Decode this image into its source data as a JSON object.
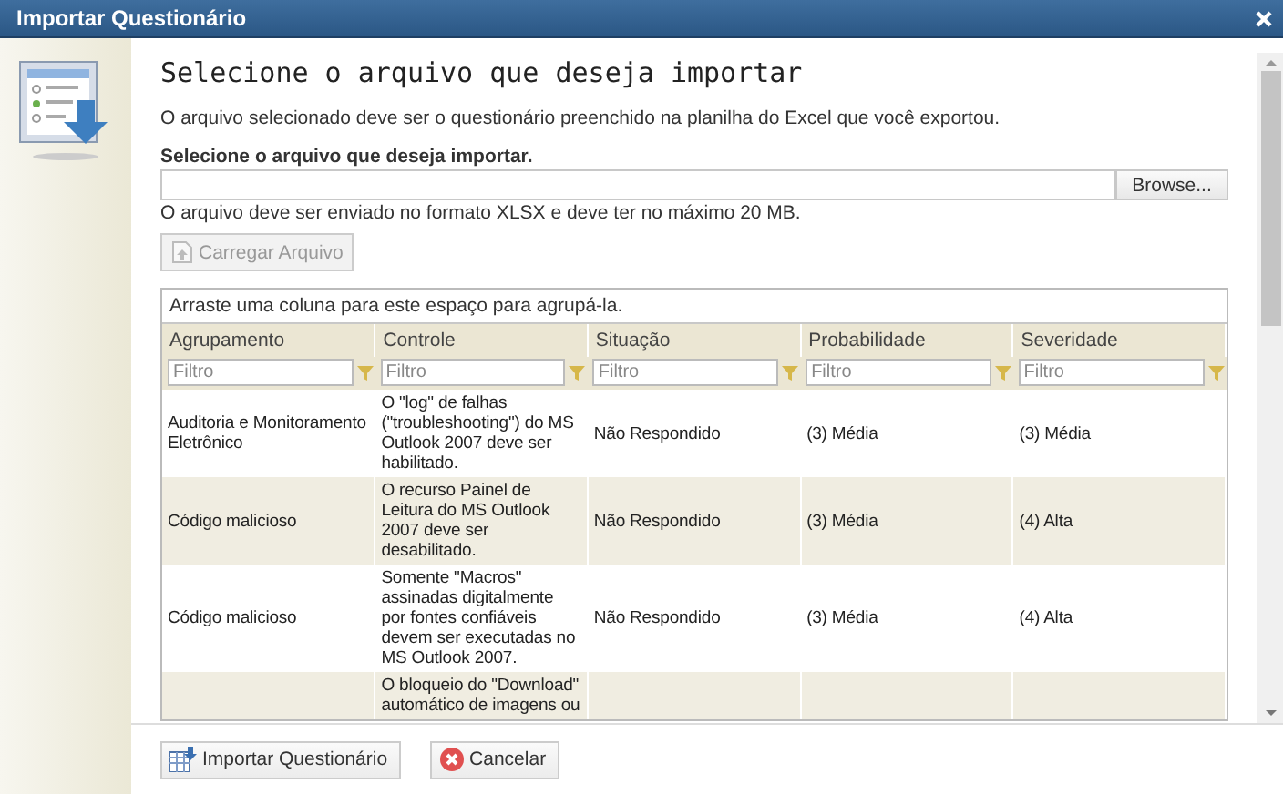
{
  "window": {
    "title": "Importar Questionário"
  },
  "heading": "Selecione o arquivo que deseja importar",
  "intro": "O arquivo selecionado deve ser o questionário preenchido na planilha do Excel que você exportou.",
  "file_field": {
    "label": "Selecione o arquivo que deseja importar.",
    "browse_button": "Browse...",
    "hint": "O arquivo deve ser enviado no formato XLSX e deve ter no máximo 20 MB."
  },
  "upload_button": {
    "label": "Carregar Arquivo",
    "disabled": true
  },
  "grid": {
    "group_hint": "Arraste uma coluna para este espaço para agrupá-la.",
    "columns": [
      {
        "title": "Agrupamento",
        "filter_placeholder": "Filtro"
      },
      {
        "title": "Controle",
        "filter_placeholder": "Filtro"
      },
      {
        "title": "Situação",
        "filter_placeholder": "Filtro"
      },
      {
        "title": "Probabilidade",
        "filter_placeholder": "Filtro"
      },
      {
        "title": "Severidade",
        "filter_placeholder": "Filtro"
      }
    ],
    "rows": [
      {
        "cells": [
          "Auditoria e Monitoramento Eletrônico",
          "O \"log\" de falhas (\"troubleshooting\") do MS Outlook 2007 deve ser habilitado.",
          "Não Respondido",
          "(3) Média",
          "(3) Média"
        ]
      },
      {
        "cells": [
          "Código malicioso",
          "O recurso Painel de Leitura do MS Outlook 2007 deve ser desabilitado.",
          "Não Respondido",
          "(3) Média",
          "(4) Alta"
        ]
      },
      {
        "cells": [
          "Código malicioso",
          "Somente \"Macros\" assinadas digitalmente por fontes confiáveis devem ser executadas no MS Outlook 2007.",
          "Não Respondido",
          "(3) Média",
          "(4) Alta"
        ]
      },
      {
        "cells": [
          "",
          "O bloqueio do \"Download\" automático de imagens ou",
          "",
          "",
          ""
        ]
      }
    ]
  },
  "buttons": [
    {
      "kind": "import",
      "label": "Importar Questionário"
    },
    {
      "kind": "cancel",
      "label": "Cancelar"
    }
  ]
}
